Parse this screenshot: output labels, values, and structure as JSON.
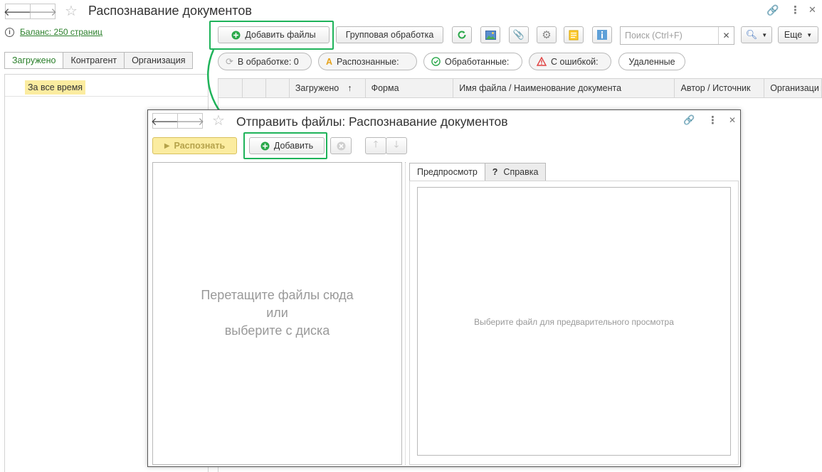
{
  "main": {
    "title": "Распознавание документов",
    "balance_link": "Баланс: 250 страниц",
    "tabs": [
      "Загружено",
      "Контрагент",
      "Организация"
    ],
    "period": "За все время",
    "add_files_label": "Добавить файлы",
    "group_processing_label": "Групповая обработка",
    "search_placeholder": "Поиск (Ctrl+F)",
    "more_label": "Еще",
    "filters": {
      "processing": "В обработке: 0",
      "recognized": "Распознанные:",
      "processed": "Обработанные:",
      "errors": "С ошибкой:",
      "deleted": "Удаленные"
    },
    "columns": {
      "loaded": "Загружено",
      "form": "Форма",
      "filename": "Имя файла / Наименование документа",
      "author": "Автор / Источник",
      "organization": "Организаци"
    }
  },
  "dialog": {
    "title": "Отправить файлы: Распознавание документов",
    "recognize_label": "Распознать",
    "add_label": "Добавить",
    "drop_line1": "Перетащите файлы сюда",
    "drop_line2": "или",
    "drop_line3": "выберите с диска",
    "tab_preview": "Предпросмотр",
    "tab_help": "Справка",
    "preview_hint": "Выберите файл для предварительного просмотра"
  },
  "colors": {
    "highlight": "#1fb35a",
    "accent_green": "#2a7f2a",
    "recognize_yellow": "#fbeca0"
  }
}
